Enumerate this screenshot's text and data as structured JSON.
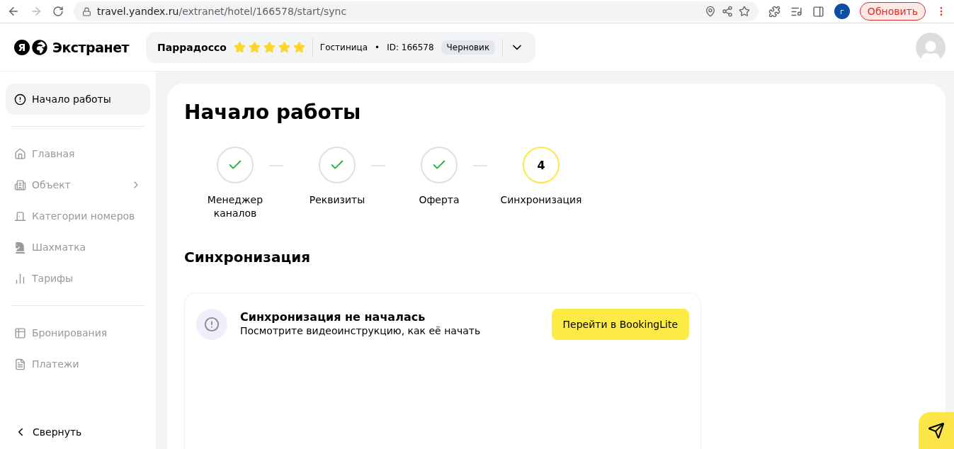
{
  "browser": {
    "url_domain": "travel.yandex.ru",
    "url_path": "/extranet/hotel/166578/start/sync",
    "profile_initial": "г",
    "update_button": "Обновить"
  },
  "header": {
    "logo_letter": "Я",
    "logo_text": "Экстранет",
    "hotel_name": "Паррадоссо",
    "stars": 5,
    "hotel_type": "Гостиница",
    "separator": "•",
    "hotel_id": "ID: 166578",
    "status": "Черновик"
  },
  "sidebar": {
    "sections": [
      {
        "items": [
          {
            "label": "Начало работы",
            "selected": true,
            "disabled": false,
            "expandable": false
          }
        ]
      },
      {
        "items": [
          {
            "label": "Главная",
            "selected": false,
            "disabled": true,
            "expandable": false
          },
          {
            "label": "Объект",
            "selected": false,
            "disabled": true,
            "expandable": true
          },
          {
            "label": "Категории номеров",
            "selected": false,
            "disabled": true,
            "expandable": false
          },
          {
            "label": "Шахматка",
            "selected": false,
            "disabled": true,
            "expandable": false
          },
          {
            "label": "Тарифы",
            "selected": false,
            "disabled": true,
            "expandable": false
          }
        ]
      },
      {
        "items": [
          {
            "label": "Бронирования",
            "selected": false,
            "disabled": true,
            "expandable": false
          },
          {
            "label": "Платежи",
            "selected": false,
            "disabled": true,
            "expandable": false
          }
        ]
      }
    ],
    "collapse": "Свернуть"
  },
  "page": {
    "title": "Начало работы",
    "steps": [
      {
        "label": "Менеджер каналов",
        "done": true
      },
      {
        "label": "Реквизиты",
        "done": true
      },
      {
        "label": "Оферта",
        "done": true
      },
      {
        "label": "Синхронизация",
        "done": false,
        "number": "4"
      }
    ],
    "section_title": "Синхронизация",
    "notice": {
      "title": "Синхронизация не началась",
      "text": "Посмотрите видеоинструкцию, как её начать",
      "button": "Перейти в BookingLite"
    }
  }
}
